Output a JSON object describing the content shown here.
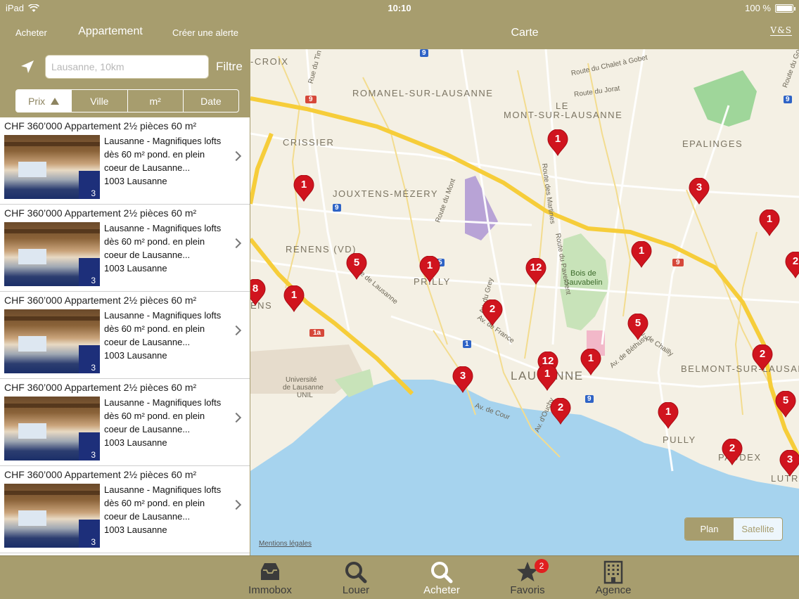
{
  "status": {
    "device": "iPad",
    "time": "10:10",
    "battery": "100 %"
  },
  "nav": {
    "back": "Acheter",
    "title": "Appartement",
    "alert": "Créer une alerte"
  },
  "search": {
    "placeholder": "Lausanne, 10km",
    "value": "",
    "filter": "Filtre"
  },
  "sort": {
    "options": [
      "Prix",
      "Ville",
      "m²",
      "Date"
    ],
    "selected": "Prix"
  },
  "listings": [
    {
      "price": "CHF 360’000 Appartement 2½ pièces 60 m²",
      "line1": "Lausanne - Magnifiques lofts",
      "line2": "dès 60 m² pond. en plein",
      "line3": "coeur de Lausanne...",
      "line4": "1003 Lausanne",
      "photos": "3"
    },
    {
      "price": "CHF 360’000 Appartement 2½ pièces 60 m²",
      "line1": "Lausanne - Magnifiques lofts",
      "line2": "dès 60 m² pond. en plein",
      "line3": "coeur de Lausanne...",
      "line4": "1003 Lausanne",
      "photos": "3"
    },
    {
      "price": "CHF 360’000 Appartement 2½ pièces 60 m²",
      "line1": "Lausanne - Magnifiques lofts",
      "line2": "dès 60 m² pond. en plein",
      "line3": "coeur de Lausanne...",
      "line4": "1003 Lausanne",
      "photos": "3"
    },
    {
      "price": "CHF 360’000 Appartement 2½ pièces 60 m²",
      "line1": "Lausanne - Magnifiques lofts",
      "line2": "dès 60 m² pond. en plein",
      "line3": "coeur de Lausanne...",
      "line4": "1003 Lausanne",
      "photos": "3"
    },
    {
      "price": "CHF 360’000 Appartement 2½ pièces 60 m²",
      "line1": "Lausanne - Magnifiques lofts",
      "line2": "dès 60 m² pond. en plein",
      "line3": "coeur de Lausanne...",
      "line4": "1003 Lausanne",
      "photos": "3"
    }
  ],
  "map": {
    "title": "Carte",
    "logo": "V&S",
    "places": [
      "-CROIX",
      "ROMANEL-SUR-LAUSANNE",
      "LE",
      "MONT-SUR-LAUSANNE",
      "CRISSIER",
      "EPALINGES",
      "JOUXTENS-MÉZERY",
      "RENENS (VD)",
      "PRILLY",
      "LAUSANNE",
      "BELMONT-SUR-LAUSAN",
      "PULLY",
      "PAUDEX",
      "LUTR",
      "ENS",
      "Bois de",
      "Sauvabelin",
      "Université",
      "de Lausanne",
      "UNIL"
    ],
    "streets": [
      "Route du Chalet à Gobet",
      "Route du Jorat",
      "Route des Martines",
      "Route du Pavement",
      "Route du Mont",
      "Rue de Lausanne",
      "Av. du Grey",
      "Av. de France",
      "Av. de Béthusy",
      "Av. de Chailly",
      "Av. de Cour",
      "Av. d'Ouchy",
      "Route du Golf",
      "Rue du Tin"
    ],
    "road_badges": [
      "9",
      "9",
      "9",
      "9",
      "1a",
      "1",
      "9",
      "5",
      "9"
    ],
    "pins": [
      "1",
      "3",
      "1",
      "1",
      "1",
      "2",
      "5",
      "1",
      "12",
      "2",
      "5",
      "8",
      "1",
      "2",
      "1",
      "12",
      "1",
      "3",
      "2",
      "5",
      "1",
      "2",
      "3"
    ],
    "mentions": "Mentions légales",
    "map_type": {
      "options": [
        "Plan",
        "Satellite"
      ],
      "selected": "Plan"
    }
  },
  "tabs": [
    {
      "label": "Immobox",
      "icon": "inbox-icon"
    },
    {
      "label": "Louer",
      "icon": "search-icon"
    },
    {
      "label": "Acheter",
      "icon": "search-icon",
      "active": true
    },
    {
      "label": "Favoris",
      "icon": "star-icon",
      "badge": "2"
    },
    {
      "label": "Agence",
      "icon": "building-icon"
    }
  ],
  "colors": {
    "brand": "#a79d6e",
    "pin": "#d0141e",
    "water": "#a6d3ee",
    "road": "#f6cd3a"
  }
}
